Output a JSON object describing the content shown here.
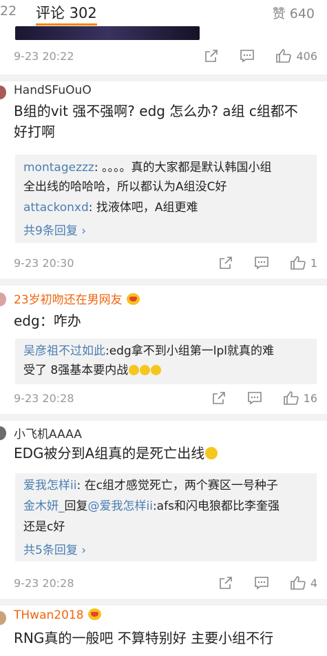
{
  "tabs": {
    "left": "22",
    "active_label": "评论",
    "active_count": "302",
    "right_label": "赞",
    "right_count": "640"
  },
  "top_meta": {
    "time": "9-23 20:22",
    "likes": "406"
  },
  "comments": [
    {
      "user": "HandSFuOuO",
      "lines": [
        "B组的vit 强不强啊? edg 怎么办? a组 c组都不",
        "好打啊"
      ],
      "replies": [
        {
          "name": "montagezzz",
          "text": ": 。。。。真的大家都是默认韩国小组",
          "cont": "全出线的哈哈哈，所以都认为A组没C好"
        },
        {
          "name": "attackonxd",
          "text": ": 找液体吧，A组更难"
        }
      ],
      "more": "共9条回复 ›",
      "time": "9-23 20:30",
      "likes": "1"
    },
    {
      "user": "23岁初吻还在男网友",
      "lines": [
        "edg：咋办"
      ],
      "replies": [
        {
          "name": "吴彦祖不过如此",
          "text": ":edg拿不到小组第一lpl就真的难",
          "cont": "受了 8强基本要内战"
        }
      ],
      "time": "9-23 20:28",
      "likes": "16"
    },
    {
      "user": "小飞机AAAA",
      "lines": [
        "EDG被分到A组真的是死亡出线"
      ],
      "replies": [
        {
          "name": "爱我怎样ii",
          "text": ": 在c组才感觉死亡，两个赛区一号种子"
        },
        {
          "name": "金木妍_",
          "text": "回复",
          "mention": "@爱我怎样ii",
          "text2": ":afs和闪电狼都比李奎强",
          "cont": "还是c好"
        }
      ],
      "more": "共5条回复 ›",
      "time": "9-23 20:28",
      "likes": "4"
    },
    {
      "user": "THwan2018",
      "lines": [
        "RNG真的一般吧 不算特别好 主要小组不行"
      ]
    }
  ],
  "colors": {
    "accent": "#ff8200",
    "link": "#4a7eb3",
    "vip": "#f0650e",
    "divider": "#f2f2f2"
  },
  "icons": [
    "share-icon",
    "comment-icon",
    "like-icon",
    "crown-badge-icon",
    "emoji-icon"
  ]
}
